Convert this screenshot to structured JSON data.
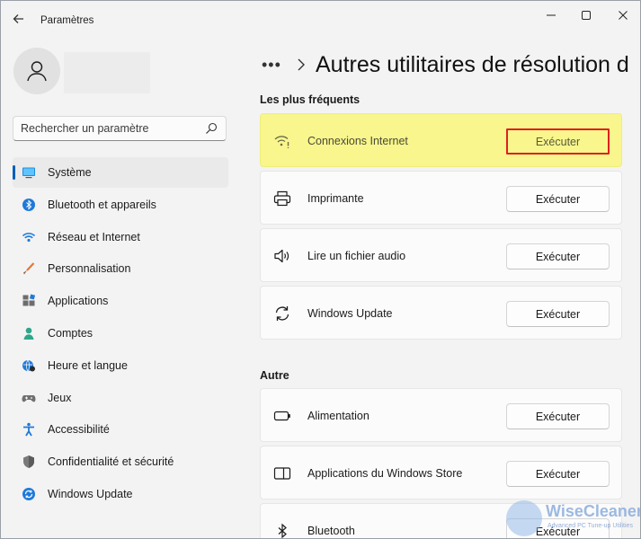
{
  "window": {
    "title": "Paramètres",
    "controls": [
      "minimize",
      "maximize",
      "close"
    ]
  },
  "search": {
    "placeholder": "Rechercher un paramètre"
  },
  "nav": {
    "items": [
      {
        "label": "Système",
        "icon": "monitor-icon",
        "active": true
      },
      {
        "label": "Bluetooth et appareils",
        "icon": "bluetooth-icon"
      },
      {
        "label": "Réseau et Internet",
        "icon": "wifi-icon"
      },
      {
        "label": "Personnalisation",
        "icon": "brush-icon"
      },
      {
        "label": "Applications",
        "icon": "apps-icon"
      },
      {
        "label": "Comptes",
        "icon": "person-icon"
      },
      {
        "label": "Heure et langue",
        "icon": "globe-clock-icon"
      },
      {
        "label": "Jeux",
        "icon": "gamepad-icon"
      },
      {
        "label": "Accessibilité",
        "icon": "accessibility-icon"
      },
      {
        "label": "Confidentialité et sécurité",
        "icon": "shield-icon"
      },
      {
        "label": "Windows Update",
        "icon": "update-icon"
      }
    ]
  },
  "main": {
    "breadcrumb_more": "•••",
    "title": "Autres utilitaires de résolution d",
    "sections": [
      {
        "title": "Les plus fréquents",
        "items": [
          {
            "label": "Connexions Internet",
            "icon": "wifi-warning-icon",
            "button": "Exécuter",
            "highlighted": true
          },
          {
            "label": "Imprimante",
            "icon": "printer-icon",
            "button": "Exécuter"
          },
          {
            "label": "Lire un fichier audio",
            "icon": "speaker-icon",
            "button": "Exécuter"
          },
          {
            "label": "Windows Update",
            "icon": "update-icon",
            "button": "Exécuter"
          }
        ]
      },
      {
        "title": "Autre",
        "items": [
          {
            "label": "Alimentation",
            "icon": "battery-icon",
            "button": "Exécuter"
          },
          {
            "label": "Applications du Windows Store",
            "icon": "store-apps-icon",
            "button": "Exécuter"
          },
          {
            "label": "Bluetooth",
            "icon": "bluetooth-icon",
            "button": "Exécuter"
          }
        ]
      }
    ]
  },
  "watermark": {
    "title": "WiseCleaner",
    "subtitle": "Advanced PC Tune-up Utilities"
  },
  "colors": {
    "accent": "#005fb8",
    "highlight": "#f8f68c",
    "highlight_border": "#e0201e",
    "background": "#f3f3f3"
  }
}
